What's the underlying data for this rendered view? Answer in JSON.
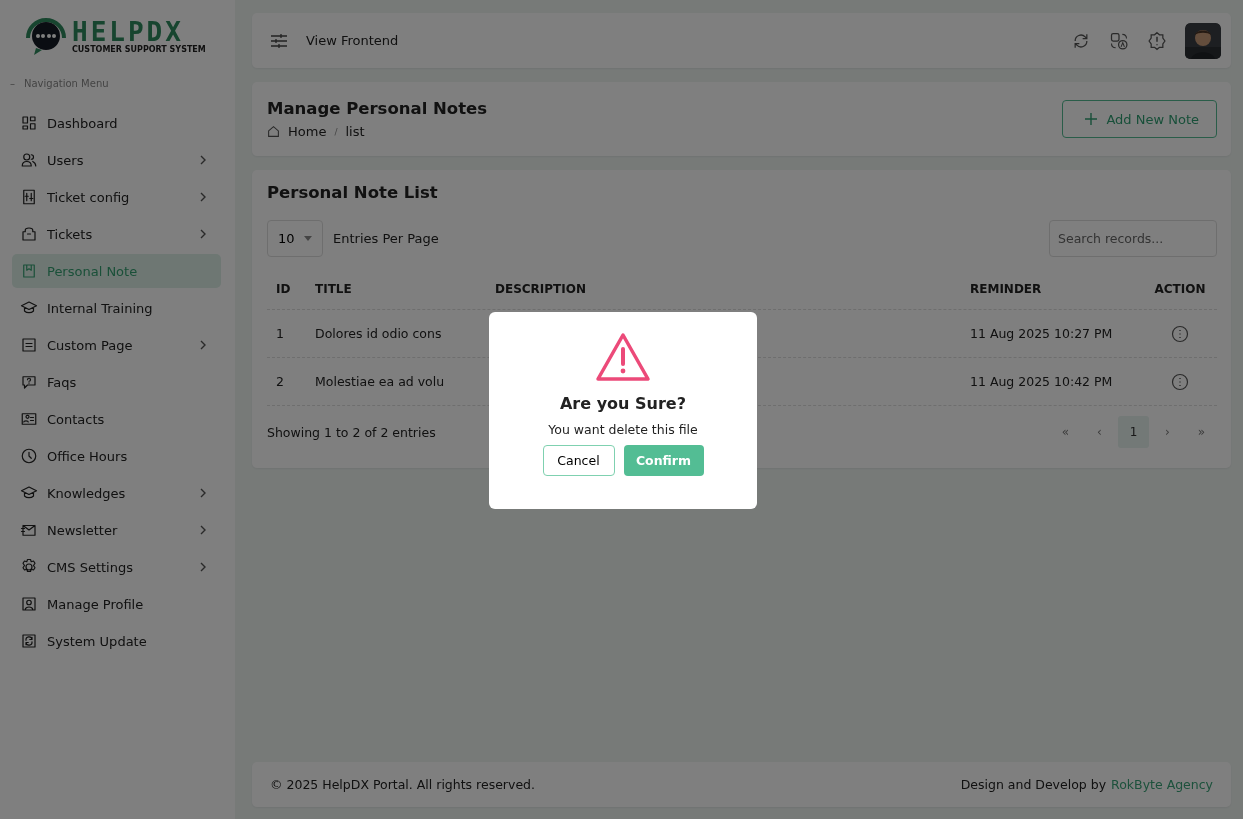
{
  "logo": {
    "name": "HELPDX",
    "tagline": "CUSTOMER SUPPORT SYSTEM"
  },
  "sidebar": {
    "heading_mark": "–",
    "heading": "Navigation Menu",
    "items": [
      {
        "label": "Dashboard",
        "has_children": false,
        "selected": false
      },
      {
        "label": "Users",
        "has_children": true,
        "selected": false
      },
      {
        "label": "Ticket config",
        "has_children": true,
        "selected": false
      },
      {
        "label": "Tickets",
        "has_children": true,
        "selected": false
      },
      {
        "label": "Personal Note",
        "has_children": false,
        "selected": true
      },
      {
        "label": "Internal Training",
        "has_children": false,
        "selected": false
      },
      {
        "label": "Custom Page",
        "has_children": true,
        "selected": false
      },
      {
        "label": "Faqs",
        "has_children": false,
        "selected": false
      },
      {
        "label": "Contacts",
        "has_children": false,
        "selected": false
      },
      {
        "label": "Office Hours",
        "has_children": false,
        "selected": false
      },
      {
        "label": "Knowledges",
        "has_children": true,
        "selected": false
      },
      {
        "label": "Newsletter",
        "has_children": true,
        "selected": false
      },
      {
        "label": "CMS Settings",
        "has_children": true,
        "selected": false
      },
      {
        "label": "Manage Profile",
        "has_children": false,
        "selected": false
      },
      {
        "label": "System Update",
        "has_children": false,
        "selected": false
      }
    ]
  },
  "topbar": {
    "link": "View Frontend"
  },
  "page_header": {
    "title": "Manage Personal Notes",
    "breadcrumb": [
      "Home",
      "list"
    ],
    "breadcrumb_separator": "/",
    "add_button": "Add New Note"
  },
  "list": {
    "title": "Personal Note List",
    "per_page": "10",
    "per_page_label": "Entries Per Page",
    "search": {
      "placeholder": "Search records..."
    },
    "table": {
      "columns": [
        "ID",
        "TITLE",
        "DESCRIPTION",
        "REMINDER",
        "ACTION"
      ],
      "rows": [
        {
          "id": "1",
          "title": "Dolores id odio cons",
          "reminder": "11 Aug 2025 10:27 PM"
        },
        {
          "id": "2",
          "title": "Molestiae ea ad volu",
          "reminder": "11 Aug 2025 10:42 PM"
        }
      ]
    },
    "summary": "Showing 1 to 2 of 2 entries",
    "pagination": [
      {
        "label": "«",
        "selected": false
      },
      {
        "label": "‹",
        "selected": false
      },
      {
        "label": "1",
        "selected": true
      },
      {
        "label": "›",
        "selected": false
      },
      {
        "label": "»",
        "selected": false
      }
    ]
  },
  "footer": {
    "copyright": "© 2025 HelpDX Portal. All rights reserved.",
    "credit": "Design and Develop by",
    "credit_link": "RokByte Agency"
  },
  "dialog": {
    "title": "Are you Sure?",
    "message": "You want delete this file",
    "cancel": "Cancel",
    "confirm": "Confirm"
  }
}
